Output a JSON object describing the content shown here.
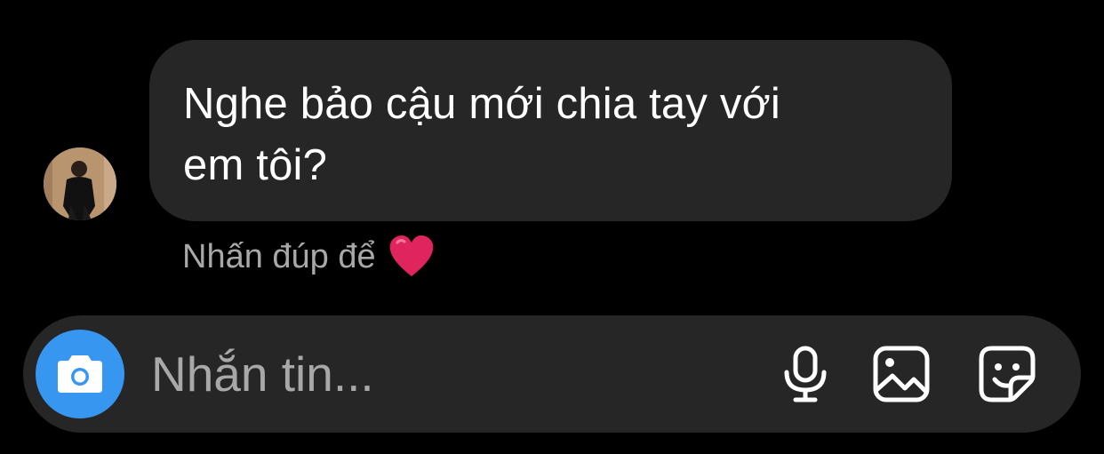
{
  "conversation": {
    "message": {
      "text_line1": "Nghe bảo cậu mới chia tay với",
      "text_line2": "em tôi?"
    },
    "double_tap_hint": {
      "text": "Nhấn đúp để",
      "emoji_icon": "heart-icon"
    }
  },
  "composer": {
    "placeholder": "Nhắn tin...",
    "icons": [
      "camera-icon",
      "microphone-icon",
      "gallery-icon",
      "sticker-icon"
    ]
  },
  "colors": {
    "background": "#000000",
    "bubble": "#262626",
    "composer": "#262626",
    "accent": "#3797f0",
    "heart": "#e0245e",
    "hint_text": "#a8a8a8"
  }
}
